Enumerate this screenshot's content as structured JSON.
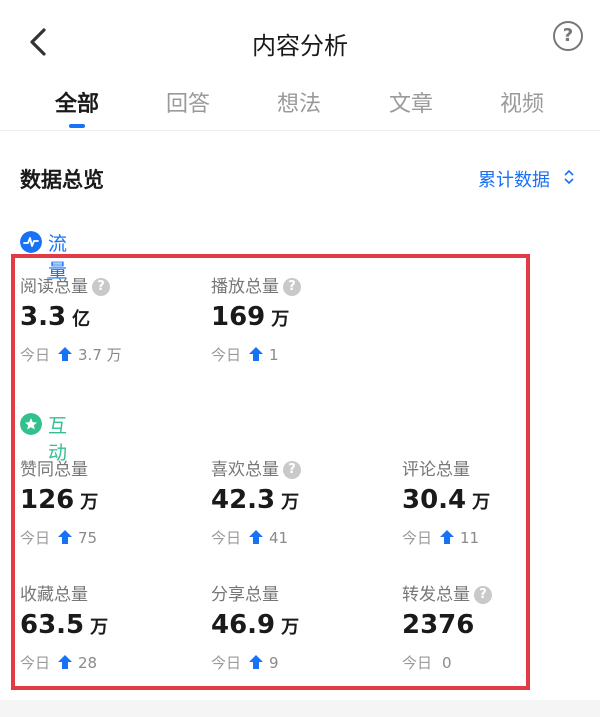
{
  "header": {
    "title": "内容分析",
    "help_icon": "?"
  },
  "tabs": [
    {
      "label": "全部",
      "active": true
    },
    {
      "label": "回答",
      "active": false
    },
    {
      "label": "想法",
      "active": false
    },
    {
      "label": "文章",
      "active": false
    },
    {
      "label": "视频",
      "active": false
    }
  ],
  "overview": {
    "title": "数据总览",
    "cumulative_label": "累计数据"
  },
  "groups": {
    "traffic": {
      "label": "流量",
      "color": "#1772f6"
    },
    "interaction": {
      "label": "互动",
      "color": "#33c08f"
    }
  },
  "today_label": "今日",
  "metrics": {
    "read": {
      "label": "阅读总量",
      "has_help": true,
      "value": "3.3",
      "unit": "亿",
      "today_delta": "3.7 万",
      "trend": "up"
    },
    "play": {
      "label": "播放总量",
      "has_help": true,
      "value": "169",
      "unit": "万",
      "today_delta": "1",
      "trend": "up"
    },
    "upvote": {
      "label": "赞同总量",
      "has_help": false,
      "value": "126",
      "unit": "万",
      "today_delta": "75",
      "trend": "up"
    },
    "like": {
      "label": "喜欢总量",
      "has_help": true,
      "value": "42.3",
      "unit": "万",
      "today_delta": "41",
      "trend": "up"
    },
    "comment": {
      "label": "评论总量",
      "has_help": false,
      "value": "30.4",
      "unit": "万",
      "today_delta": "11",
      "trend": "up"
    },
    "collect": {
      "label": "收藏总量",
      "has_help": false,
      "value": "63.5",
      "unit": "万",
      "today_delta": "28",
      "trend": "up"
    },
    "share": {
      "label": "分享总量",
      "has_help": false,
      "value": "46.9",
      "unit": "万",
      "today_delta": "9",
      "trend": "up"
    },
    "forward": {
      "label": "转发总量",
      "has_help": true,
      "value": "2376",
      "unit": "",
      "today_delta": "0",
      "trend": "none"
    }
  },
  "colors": {
    "accent": "#1772f6",
    "highlight_border": "#e23b46",
    "up_arrow": "#1772f6"
  }
}
